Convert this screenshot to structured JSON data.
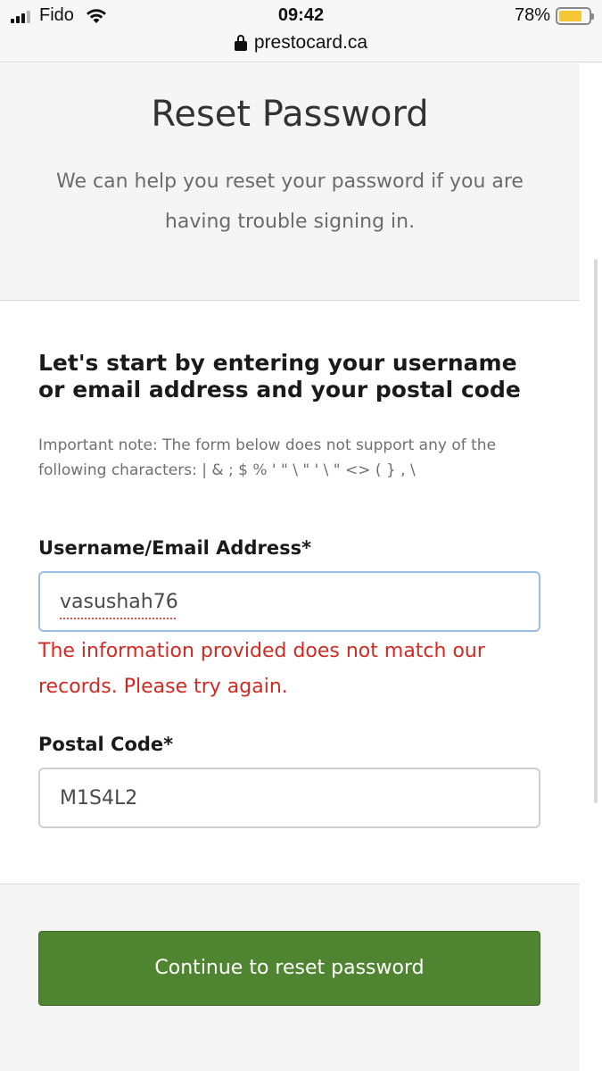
{
  "status_bar": {
    "carrier": "Fido",
    "time": "09:42",
    "battery": "78%",
    "battery_level": 0.78
  },
  "browser": {
    "url": "prestocard.ca"
  },
  "header": {
    "title": "Reset Password",
    "subtitle": "We can help you reset your password if you are having trouble signing in."
  },
  "form": {
    "lead": "Let's start by entering your username or email address and your postal code",
    "note": "Important note: The form below does not support any of the following characters: | & ; $ % ' \" \\ \" ' \\ \" <> ( } , \\",
    "username_label": "Username/Email Address*",
    "username_value": "vasushah76",
    "error_message": "The information provided does not match our records. Please try again.",
    "postal_label": "Postal Code*",
    "postal_value": "M1S4L2"
  },
  "actions": {
    "continue_label": "Continue to reset password"
  },
  "colors": {
    "button_green": "#4f8530",
    "error_red": "#d12a22",
    "focus_border": "#9cbce4",
    "battery_yellow": "#f2c635"
  }
}
